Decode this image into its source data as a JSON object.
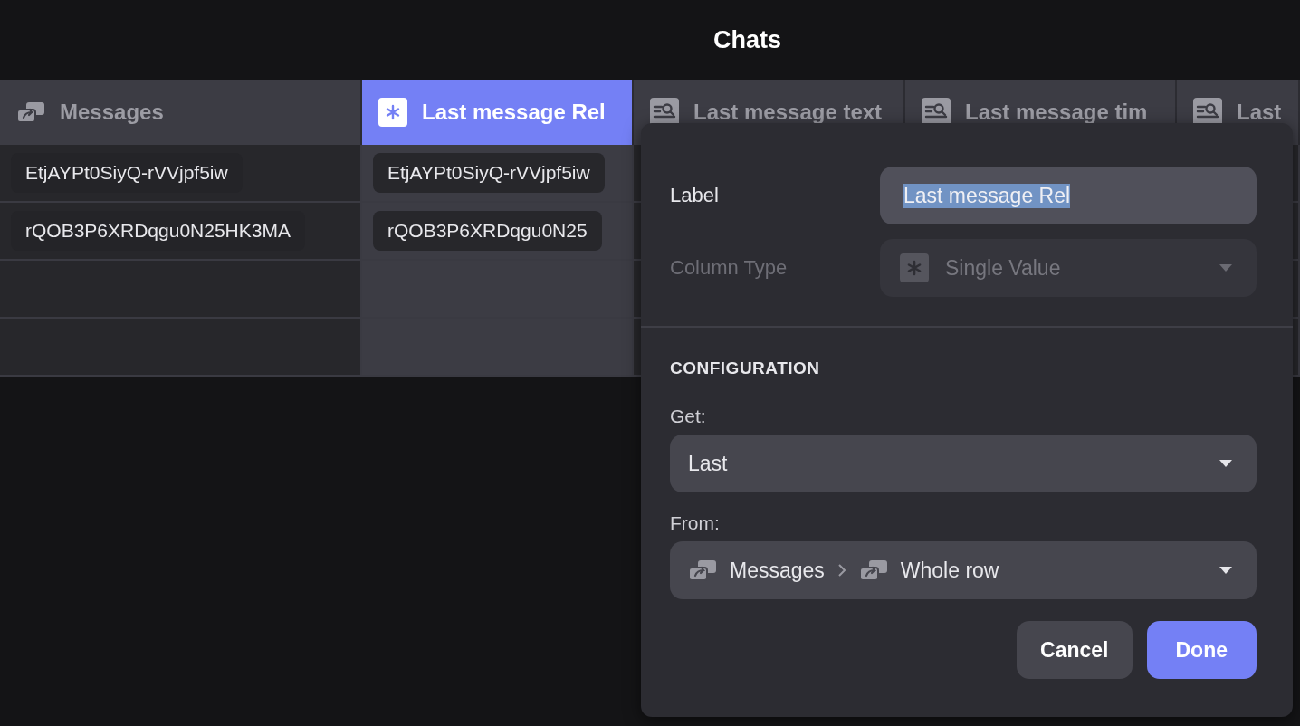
{
  "window": {
    "title": "Chats"
  },
  "table": {
    "columns": [
      {
        "label": "Messages",
        "kind": "relation",
        "selected": false
      },
      {
        "label": "Last message Rel",
        "kind": "single-value",
        "selected": true
      },
      {
        "label": "Last message text",
        "kind": "lookup",
        "selected": false
      },
      {
        "label": "Last message tim",
        "kind": "lookup",
        "selected": false
      },
      {
        "label": "Last",
        "kind": "lookup",
        "selected": false
      }
    ],
    "rows": [
      {
        "cells": [
          "EtjAYPt0SiyQ-rVVjpf5iw",
          "EtjAYPt0SiyQ-rVVjpf5iw"
        ]
      },
      {
        "cells": [
          "rQOB3P6XRDqgu0N25HK3MA",
          "rQOB3P6XRDqgu0N25"
        ]
      }
    ]
  },
  "popover": {
    "label_field": {
      "label": "Label",
      "value": "Last message Rel",
      "text_selected": true
    },
    "column_type_field": {
      "label": "Column Type",
      "value": "Single Value",
      "kind": "single-value",
      "disabled": true
    },
    "section_title": "CONFIGURATION",
    "get_field": {
      "label": "Get:",
      "value": "Last"
    },
    "from_field": {
      "label": "From:",
      "path": [
        {
          "label": "Messages",
          "kind": "relation"
        },
        {
          "label": "Whole row",
          "kind": "relation"
        }
      ]
    },
    "buttons": [
      {
        "label": "Cancel",
        "kind": "secondary"
      },
      {
        "label": "Done",
        "kind": "primary"
      }
    ]
  }
}
